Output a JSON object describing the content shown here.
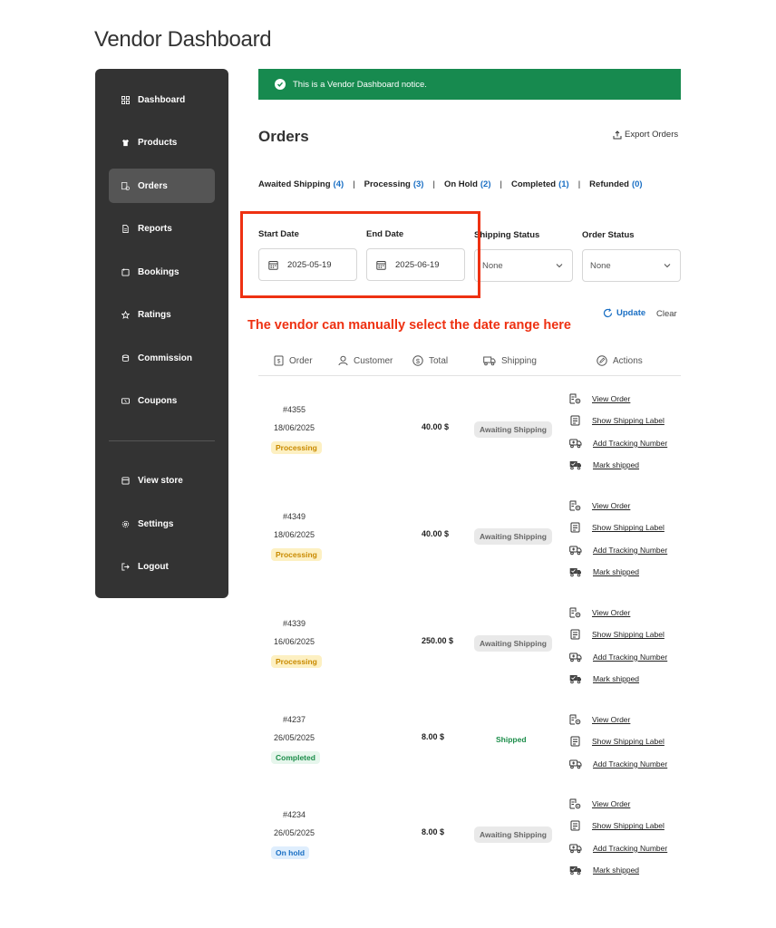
{
  "page": {
    "title": "Vendor Dashboard"
  },
  "sidebar": {
    "items": [
      {
        "label": "Dashboard",
        "icon": "grid-icon"
      },
      {
        "label": "Products",
        "icon": "shirt-icon"
      },
      {
        "label": "Orders",
        "icon": "orders-icon",
        "active": true
      },
      {
        "label": "Reports",
        "icon": "file-icon"
      },
      {
        "label": "Bookings",
        "icon": "calendar-icon"
      },
      {
        "label": "Ratings",
        "icon": "star-icon"
      },
      {
        "label": "Commission",
        "icon": "coins-icon"
      },
      {
        "label": "Coupons",
        "icon": "ticket-icon"
      }
    ],
    "bottom_items": [
      {
        "label": "View store",
        "icon": "store-icon"
      },
      {
        "label": "Settings",
        "icon": "gear-icon"
      },
      {
        "label": "Logout",
        "icon": "logout-icon"
      }
    ]
  },
  "notice": {
    "text": "This is a Vendor Dashboard notice.",
    "color": "#178a4f"
  },
  "orders": {
    "title": "Orders",
    "export_label": "Export Orders",
    "filters": [
      {
        "label": "Awaited Shipping",
        "count": "(4)"
      },
      {
        "label": "Processing",
        "count": "(3)"
      },
      {
        "label": "On Hold",
        "count": "(2)"
      },
      {
        "label": "Completed",
        "count": "(1)"
      },
      {
        "label": "Refunded",
        "count": "(0)"
      }
    ],
    "separator": "|",
    "start_date": {
      "label": "Start Date",
      "value": "2025-05-19"
    },
    "end_date": {
      "label": "End Date",
      "value": "2025-06-19"
    },
    "shipping_status": {
      "label": "Shipping Status",
      "value": "None"
    },
    "order_status": {
      "label": "Order Status",
      "value": "None"
    },
    "annotation": "The vendor can manually select the date range here",
    "update_label": "Update",
    "clear_label": "Clear",
    "columns": [
      "Order",
      "Customer",
      "Total",
      "Shipping",
      "Actions"
    ],
    "rows": [
      {
        "id": "#4355",
        "date": "18/06/2025",
        "status": "Processing",
        "total": "40.00 $",
        "shipping": "Awaiting Shipping",
        "actions": [
          "View Order",
          "Show Shipping Label",
          "Add Tracking Number",
          "Mark shipped"
        ]
      },
      {
        "id": "#4349",
        "date": "18/06/2025",
        "status": "Processing",
        "total": "40.00 $",
        "shipping": "Awaiting Shipping",
        "actions": [
          "View Order",
          "Show Shipping Label",
          "Add Tracking Number",
          "Mark shipped"
        ]
      },
      {
        "id": "#4339",
        "date": "16/06/2025",
        "status": "Processing",
        "total": "250.00 $",
        "shipping": "Awaiting Shipping",
        "actions": [
          "View Order",
          "Show Shipping Label",
          "Add Tracking Number",
          "Mark shipped"
        ]
      },
      {
        "id": "#4237",
        "date": "26/05/2025",
        "status": "Completed",
        "total": "8.00 $",
        "shipping": "Shipped",
        "actions": [
          "View Order",
          "Show Shipping Label",
          "Add Tracking Number"
        ]
      },
      {
        "id": "#4234",
        "date": "26/05/2025",
        "status": "On hold",
        "total": "8.00 $",
        "shipping": "Awaiting Shipping",
        "actions": [
          "View Order",
          "Show Shipping Label",
          "Add Tracking Number",
          "Mark shipped"
        ]
      }
    ]
  },
  "colors": {
    "sidebar": "#333333",
    "accent": "#1a6fc4",
    "annotation": "#ee3112"
  }
}
